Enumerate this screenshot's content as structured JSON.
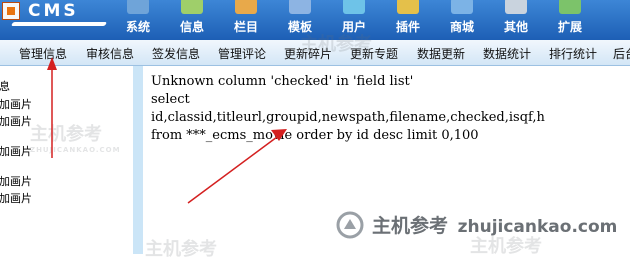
{
  "logo": {
    "text": "CMS"
  },
  "top_nav": [
    {
      "label": "系统",
      "icon": "system-icon",
      "color": "#6fa4d9"
    },
    {
      "label": "信息",
      "icon": "info-icon",
      "color": "#9fcf6a"
    },
    {
      "label": "栏目",
      "icon": "column-icon",
      "color": "#e8a94a"
    },
    {
      "label": "模板",
      "icon": "template-icon",
      "color": "#8db4e3"
    },
    {
      "label": "用户",
      "icon": "user-icon",
      "color": "#6ec3e8"
    },
    {
      "label": "插件",
      "icon": "plugin-icon",
      "color": "#e4c04a"
    },
    {
      "label": "商城",
      "icon": "shop-icon",
      "color": "#7cb3e6"
    },
    {
      "label": "其他",
      "icon": "other-icon",
      "color": "#c9d3de"
    },
    {
      "label": "扩展",
      "icon": "extend-icon",
      "color": "#7cc36a"
    }
  ],
  "menu_items": [
    "管理信息",
    "审核信息",
    "签发信息",
    "管理评论",
    "更新碎片",
    "更新专题",
    "数据更新",
    "数据统计",
    "排行统计",
    "后台"
  ],
  "sidebar": {
    "heading": "息",
    "items": [
      "加画片",
      "加画片",
      "加画片",
      "加画片",
      "加画片"
    ]
  },
  "error": {
    "lines": [
      "Unknown column 'checked' in 'field list'",
      "select",
      "id,classid,titleurl,groupid,newspath,filename,checked,isqf,h",
      "from ***_ecms_movie order by id desc limit 0,100"
    ]
  },
  "watermark": {
    "main_cn": "主机参考",
    "main_url": "zhujicankao.com",
    "small_cn": "主机参考",
    "small_url": "ZHUJICANKAO.COM"
  },
  "colors": {
    "topbar": "#2a6fc3",
    "arrow": "#d42020"
  }
}
